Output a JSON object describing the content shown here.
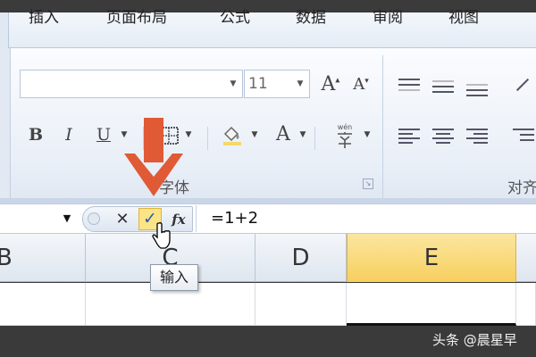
{
  "tabs": [
    {
      "label": "插入"
    },
    {
      "label": "页面布局"
    },
    {
      "label": "公式"
    },
    {
      "label": "数据"
    },
    {
      "label": "审阅"
    },
    {
      "label": "视图"
    }
  ],
  "ribbon": {
    "font_size_value": "11",
    "grow_font_label": "A",
    "shrink_font_label": "A",
    "bold_label": "B",
    "italic_label": "I",
    "underline_label": "U",
    "font_color_label": "A",
    "phonetic_label": "wén",
    "font_group_label": "字体",
    "align_group_label": "对齐"
  },
  "formula_bar": {
    "cancel_label": "✕",
    "enter_label": "✓",
    "insert_function_label": "fx",
    "formula": "=1+2"
  },
  "columns": [
    {
      "label": "B"
    },
    {
      "label": "C"
    },
    {
      "label": "D"
    },
    {
      "label": "E"
    }
  ],
  "tooltip": {
    "text": "输入"
  },
  "watermark": {
    "text": "头条 @晨星早"
  },
  "colors": {
    "selected_column": "#f7cf5c",
    "enter_button": "#fbe486",
    "arrow": "#e05a36"
  },
  "icons": [
    "chevron-down-icon",
    "border-icon",
    "fill-color-icon",
    "phonetic-icon",
    "align-icon",
    "cursor-icon",
    "red-arrow-icon"
  ]
}
